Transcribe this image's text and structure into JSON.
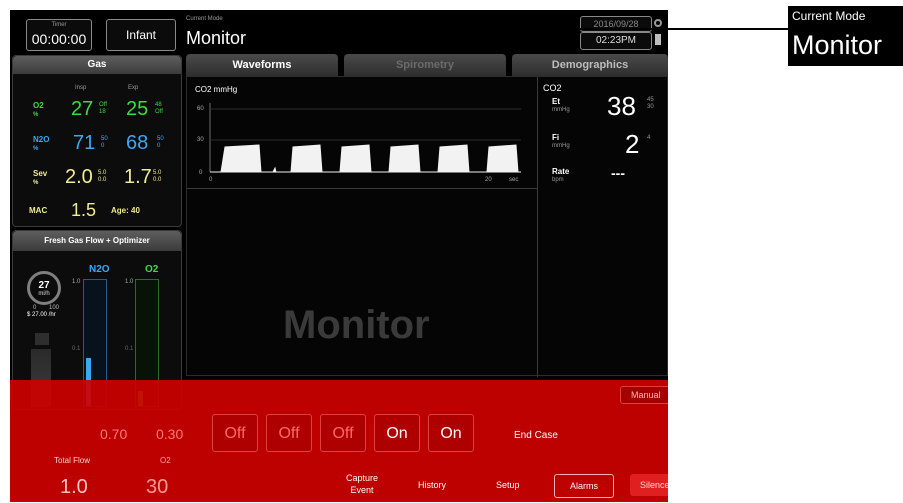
{
  "header": {
    "timer_label": "Timer",
    "timer_value": "00:00:00",
    "patient_type": "Infant",
    "mode_label": "Current Mode",
    "mode_value": "Monitor",
    "date": "2016/09/28",
    "time": "02:23PM"
  },
  "callout": {
    "label": "Current Mode",
    "value": "Monitor"
  },
  "gas_panel": {
    "title": "Gas",
    "col_insp": "Insp",
    "col_exp": "Exp",
    "rows": [
      {
        "name": "O2",
        "unit": "%",
        "insp": "27",
        "exp": "25",
        "hi": "Off",
        "lo": "18",
        "hi2": "48",
        "lo2": "Off"
      },
      {
        "name": "N2O",
        "unit": "%",
        "insp": "71",
        "exp": "68",
        "hi": "50",
        "lo": "0",
        "hi2": "50",
        "lo2": "0"
      },
      {
        "name": "Sev",
        "unit": "%",
        "insp": "2.0",
        "exp": "1.7",
        "hi": "5.0",
        "lo": "0.0",
        "hi2": "5.0",
        "lo2": "0.0"
      }
    ],
    "mac_label": "MAC",
    "mac_value": "1.5",
    "age_label": "Age: 40"
  },
  "fgf_panel": {
    "title": "Fresh Gas Flow + Optimizer",
    "gauge_value": "27",
    "gauge_unit": "mi/h",
    "gauge_tick_min": "0",
    "gauge_tick_max": "100",
    "cost": "$ 27.00 /hr",
    "n2o_label": "N2O",
    "o2_label": "O2",
    "scale_top": "1.0",
    "scale_mid": "0.1",
    "n2o_fill": 0.38,
    "o2_fill": 0.12
  },
  "tabs": {
    "waveforms": "Waveforms",
    "spirometry": "Spirometry",
    "demographics": "Demographics"
  },
  "waveform": {
    "title": "CO2 mmHg",
    "y_ticks": [
      "60",
      "30",
      "0"
    ],
    "x_ticks": [
      "0",
      "20",
      "sec"
    ],
    "overlay_text": "Monitor"
  },
  "co2_panel": {
    "title": "CO2",
    "et_label": "Et",
    "et_unit": "mmHg",
    "et_value": "38",
    "et_hi": "45",
    "et_lo": "30",
    "fi_label": "Fi",
    "fi_unit": "mmHg",
    "fi_value": "2",
    "fi_hi": "4",
    "rate_label": "Rate",
    "rate_unit": "bpm",
    "rate_value": "---"
  },
  "bottom_bar": {
    "left_values": [
      "0.70",
      "0.30"
    ],
    "total_flow_label": "Total Flow",
    "total_flow_value": "1.0",
    "o2_label": "O2",
    "o2_value": "30",
    "toggles": [
      "Off",
      "Off",
      "Off",
      "On",
      "On"
    ],
    "end_case": "End Case",
    "capture_event": "Capture Event",
    "history": "History",
    "setup": "Setup",
    "alarms": "Alarms",
    "silence": "Silence",
    "manual": "Manual"
  },
  "colors": {
    "alarm_red": "#cd0000",
    "n2o_blue": "#38a8f5",
    "o2_green": "#3ddc3d",
    "sev_yellow": "#f1ec90"
  }
}
